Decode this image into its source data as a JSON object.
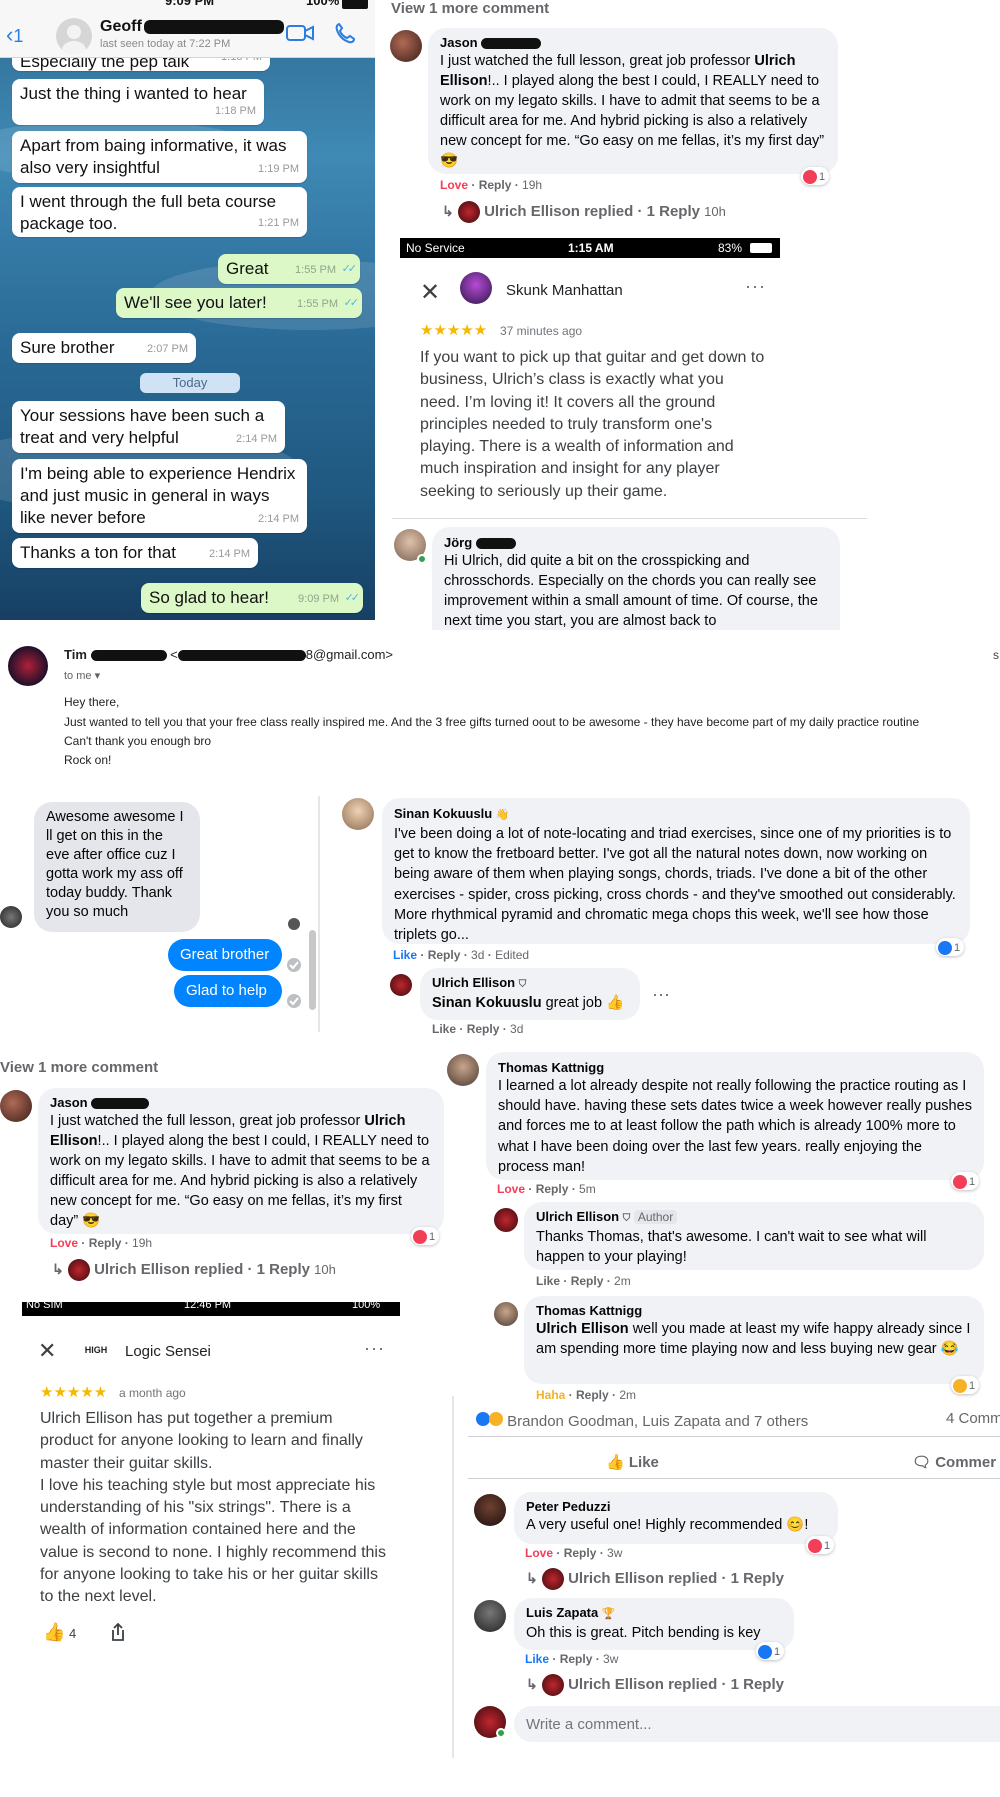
{
  "whatsapp": {
    "status_time": "9:09 PM",
    "status_battery": "100%",
    "back_count": "1",
    "contact_name": "Geoff",
    "last_seen": "last seen today at 7:22 PM",
    "messages": [
      {
        "text": "Especially the pep talk",
        "time": "1:18 PM",
        "dir": "in"
      },
      {
        "text": "Just the thing i wanted to hear",
        "time": "1:18 PM",
        "dir": "in"
      },
      {
        "text": "Apart from baing informative, it was also very insightful",
        "time": "1:19 PM",
        "dir": "in"
      },
      {
        "text": "I went through the full beta course package too.",
        "time": "1:21 PM",
        "dir": "in"
      },
      {
        "text": "Great",
        "time": "1:55 PM",
        "dir": "out"
      },
      {
        "text": "We'll see you later!",
        "time": "1:55 PM",
        "dir": "out"
      },
      {
        "text": "Sure brother",
        "time": "2:07 PM",
        "dir": "in"
      },
      {
        "text": "Your sessions have been such a treat and very helpful",
        "time": "2:14 PM",
        "dir": "in"
      },
      {
        "text": "I'm being able to experience Hendrix and just music in general in ways like never before",
        "time": "2:14 PM",
        "dir": "in"
      },
      {
        "text": "Thanks a ton for that",
        "time": "2:14 PM",
        "dir": "in"
      },
      {
        "text": "So glad to hear!",
        "time": "9:09 PM",
        "dir": "out"
      }
    ],
    "date_divider": "Today"
  },
  "jason_top": {
    "view_more": "View 1 more comment",
    "name": "Jason",
    "text_a": "I just watched the full lesson, great job professor ",
    "text_bold": "Ulrich Ellison",
    "text_b": "!.. I played along the best I could, I REALLY need to work on my legato skills. I have to admit that seems to be a difficult area for me. And hybrid picking is also a relatively new concept for me. “Go easy on me fellas, it’s my first day”",
    "react_love": "Love",
    "react_reply": "Reply",
    "age": "19h",
    "reaction_count": "1",
    "replied": "Ulrich Ellison replied · 1 Reply",
    "replied_age": "10h"
  },
  "skunk_review": {
    "status_carrier": "No Service",
    "status_time": "1:15 AM",
    "status_battery": "83%",
    "name": "Skunk Manhattan",
    "stars": "★★★★★",
    "age": "37 minutes ago",
    "text": "If you want to pick up that guitar and get down to business, Ulrich’s class is exactly what you need. I’m loving it! It covers all the ground principles needed to truly transform one's playing. There is a wealth of information and much inspiration and insight for any player seeking to seriously up their game."
  },
  "jorg": {
    "name": "Jörg",
    "text": "Hi Ulrich, did quite a bit on the crosspicking and chrosschords. Especially on the chords you can really see improvement within a small amount of time. Of course, the next time you start, you are almost back to"
  },
  "gmail": {
    "from_name": "Tim",
    "from_email_tail": "8@gmail.com>",
    "to": "to me",
    "truncated_char": "s",
    "body": [
      "Hey there,",
      "Just wanted to tell you that your free class really inspired me. And the 3 free gifts turned oout to be awesome - they have become part of my daily practice routine",
      "Can't thank you enough bro",
      "Rock on!"
    ]
  },
  "messenger": {
    "incoming": "Awesome awesome I ll get on this in the eve after office cuz I gotta work my ass off today buddy. Thank you so much",
    "out1": "Great brother",
    "out2": "Glad to help"
  },
  "sinan": {
    "name": "Sinan Kokuuslu",
    "text": "I've been doing a lot of note-locating and triad exercises, since one of my priorities is to get to know the fretboard better. I've got all the natural notes down, now working on being aware of them when playing songs, chords, triads. I've done a bit of the other exercises - spider, cross picking, cross chords - and they've smoothed out considerably. More rhythmical pyramid and chromatic mega chops this week, we'll see how those triplets go...",
    "like": "Like",
    "reply": "Reply",
    "age": "3d",
    "edited": "Edited",
    "reaction_count": "1",
    "reply_name": "Ulrich Ellison",
    "reply_mention": "Sinan Kokuuslu",
    "reply_text": " great job 👍",
    "reply_like": "Like",
    "reply_reply": "Reply",
    "reply_age": "3d"
  },
  "jason_bottom": {
    "view_more": "View 1 more comment",
    "name": "Jason",
    "text_a": "I just watched the full lesson, great job professor ",
    "text_bold": "Ulrich Ellison",
    "text_b": "!.. I played along the best I could, I REALLY need to work on my legato skills. I have to admit that seems to be a difficult area for me. And hybrid picking is also a relatively new concept for me. “Go easy on me fellas, it’s my first day”",
    "react_love": "Love",
    "react_reply": "Reply",
    "age": "19h",
    "reaction_count": "1",
    "replied": "Ulrich Ellison replied · 1 Reply",
    "replied_age": "10h"
  },
  "logic_review": {
    "status_carrier": "No SIM",
    "status_time": "12:46 PM",
    "status_battery": "100%",
    "logo_text": "HIGH",
    "name": "Logic Sensei",
    "stars": "★★★★★",
    "age": "a month ago",
    "text": "Ulrich Ellison has put together a premium product for anyone looking to learn and finally master their guitar skills.\nI love his teaching style but most appreciate his understanding of his \"six strings\". There is a wealth of information contained here and the value is second to none. I highly recommend this for anyone looking to take his or her guitar skills to the next level.",
    "likes": "4"
  },
  "thomas": {
    "name": "Thomas Kattnigg",
    "text": "I learned a lot already despite not really following the practice routing as I should have. having these sets dates twice a week however really pushes and forces me to at least follow the path which is already 100% more to what I have been doing over the last few years. really enjoying the process man!",
    "love": "Love",
    "reply": "Reply",
    "age": "5m",
    "reaction_count": "1",
    "ulrich_name": "Ulrich Ellison",
    "author_badge": "Author",
    "ulrich_text": "Thanks Thomas, that's awesome. I can't wait to see what will happen to your playing!",
    "ulrich_like": "Like",
    "ulrich_reply": "Reply",
    "ulrich_age": "2m",
    "reply2_name": "Thomas Kattnigg",
    "reply2_mention": "Ulrich Ellison",
    "reply2_text": " well you made at least my wife happy already since I am spending more time playing now and less buying new gear 😂",
    "reply2_haha": "Haha",
    "reply2_reply": "Reply",
    "reply2_age": "2m",
    "reply2_count": "1"
  },
  "fb_post": {
    "reactions_line": "Brandon Goodman, Luis Zapata and 7 others",
    "comments_count": "4 Comm",
    "like_button": "Like",
    "comment_button": "Commer",
    "peter_name": "Peter Peduzzi",
    "peter_text": "A very useful one! Highly recommended 😊!",
    "peter_love": "Love",
    "peter_reply": "Reply",
    "peter_age": "3w",
    "peter_count": "1",
    "peter_replied": "Ulrich Ellison replied · 1 Reply",
    "luis_name": "Luis Zapata",
    "luis_text": "Oh this is great. Pitch bending is key",
    "luis_like": "Like",
    "luis_reply": "Reply",
    "luis_age": "3w",
    "luis_count": "1",
    "luis_replied": "Ulrich Ellison replied · 1 Reply",
    "write_placeholder": "Write a comment..."
  },
  "colors": {
    "whatsapp_out": "#dcf8c6",
    "fb_blue": "#1877f2",
    "love_red": "#f33e58",
    "messenger_blue": "#0084ff",
    "star_gold": "#f5b800"
  }
}
